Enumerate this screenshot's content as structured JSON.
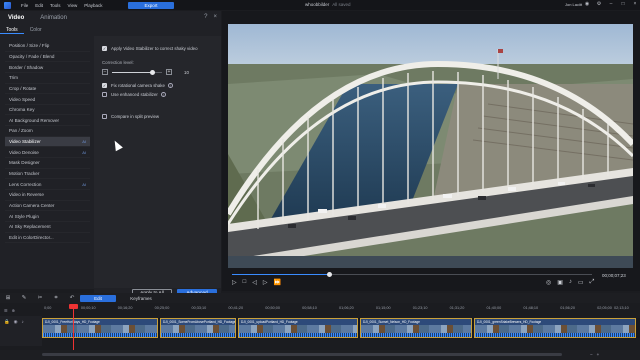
{
  "menubar": {
    "menus": [
      "File",
      "Edit",
      "Tools",
      "View",
      "Playback"
    ],
    "export_label": "Export",
    "project_title": "whoobbilder",
    "project_status": "All saved",
    "user_name": "Jon Lacitt"
  },
  "panel": {
    "tabs": [
      "Video",
      "Animation"
    ],
    "subtabs": [
      "Tools",
      "Color"
    ],
    "tools": [
      {
        "label": "Position / Size / Flip",
        "flag": ""
      },
      {
        "label": "Opacity / Fade / Blend",
        "flag": ""
      },
      {
        "label": "Border / Shadow",
        "flag": ""
      },
      {
        "label": "Trim",
        "flag": ""
      },
      {
        "label": "Crop / Rotate",
        "flag": ""
      },
      {
        "label": "Video Speed",
        "flag": ""
      },
      {
        "label": "Chroma Key",
        "flag": ""
      },
      {
        "label": "AI Background Remover",
        "flag": ""
      },
      {
        "label": "Pan / Zoom",
        "flag": ""
      },
      {
        "label": "Video Stabilizer",
        "flag": "AI"
      },
      {
        "label": "Video Denoise",
        "flag": "AI"
      },
      {
        "label": "Mask Designer",
        "flag": ""
      },
      {
        "label": "Motion Tracker",
        "flag": ""
      },
      {
        "label": "Lens Correction",
        "flag": "AI"
      },
      {
        "label": "Video in Reverse",
        "flag": ""
      },
      {
        "label": "Action Camera Center",
        "flag": ""
      },
      {
        "label": "AI Style Plugin",
        "flag": ""
      },
      {
        "label": "AI Sky Replacement",
        "flag": ""
      },
      {
        "label": "Edit in ColorDirector...",
        "flag": ""
      }
    ],
    "stabilizer": {
      "apply_label": "Apply Video Stabilizer to correct shaky video",
      "apply_checked": true,
      "level_label": "Correction level:",
      "level_value": "10",
      "level_fraction": 0.8,
      "rotational_label": "Fix rotational camera shake",
      "rotational_checked": true,
      "enhanced_label": "Use enhanced stabilizer",
      "enhanced_checked": false,
      "compare_label": "Compare in split preview",
      "compare_checked": false
    },
    "apply_all_label": "Apply to All",
    "advanced_label": "Advanced"
  },
  "preview": {
    "timecode": "00;00;07;23",
    "progress_fraction": 0.27
  },
  "timeline": {
    "edit_label": "Edit",
    "keyframes_label": "Keyframes",
    "ruler": [
      "0;00",
      "00;00;10",
      "00;16;20",
      "00;25;00",
      "00;33;10",
      "00;41;20",
      "00;50;00",
      "00;58;10",
      "01;06;20",
      "01;15;00",
      "01;23;10",
      "01;31;20",
      "01;40;00",
      "01;48;10",
      "01;56;20",
      "02;05;00",
      "02;13;10"
    ],
    "clips": [
      {
        "label": "DJI_0001_FreeHorWays_HD_Footage"
      },
      {
        "label": "DJI_0001_SceneFromAbovePortland_HD_Footage"
      },
      {
        "label": "DJI_0001_uploadPortland_HD_Footage"
      },
      {
        "label": "DJI_0001_Sunset_Nelson_HD_Footage"
      },
      {
        "label": "DJI_0001_greenSrlakeBrewers_HD_Footage"
      }
    ]
  }
}
